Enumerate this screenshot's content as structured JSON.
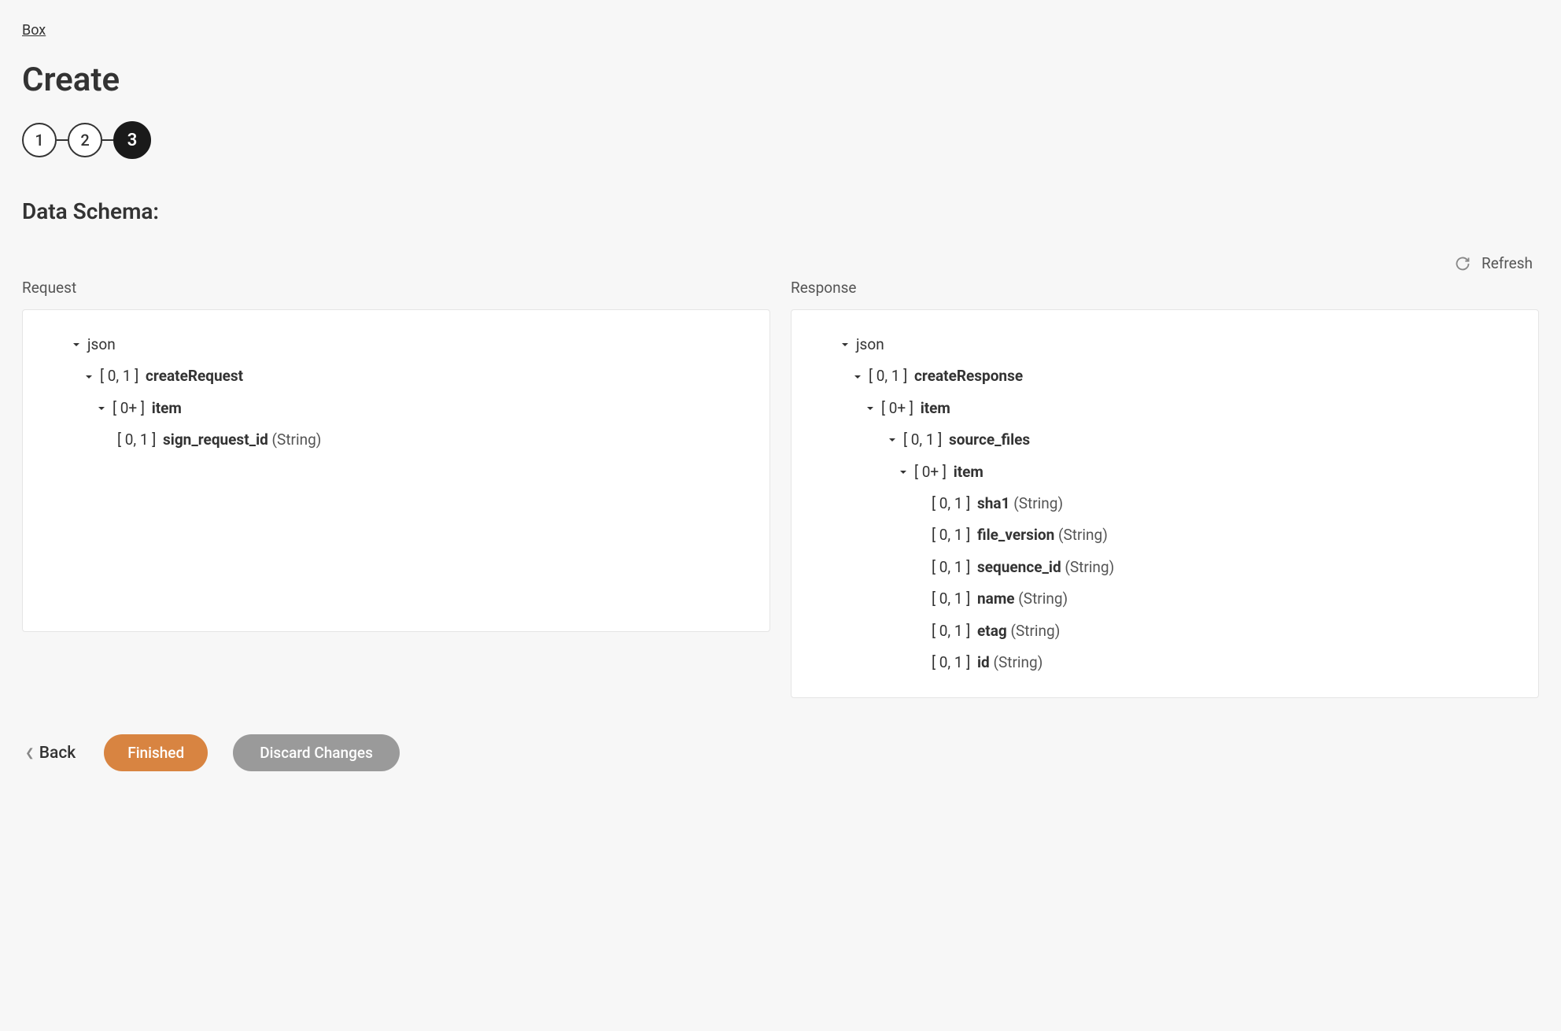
{
  "breadcrumb": {
    "label": "Box"
  },
  "page": {
    "title": "Create"
  },
  "stepper": {
    "step1": "1",
    "step2": "2",
    "step3": "3"
  },
  "section": {
    "title": "Data Schema:"
  },
  "refresh": {
    "label": "Refresh"
  },
  "request": {
    "label": "Request",
    "tree": {
      "root": "json",
      "node1": {
        "cardinality": "[ 0, 1 ]",
        "name": "createRequest"
      },
      "node2": {
        "cardinality": "[ 0+ ]",
        "name": "item"
      },
      "node3": {
        "cardinality": "[ 0, 1 ]",
        "name": "sign_request_id",
        "type": "(String)"
      }
    }
  },
  "response": {
    "label": "Response",
    "tree": {
      "root": "json",
      "node1": {
        "cardinality": "[ 0, 1 ]",
        "name": "createResponse"
      },
      "node2": {
        "cardinality": "[ 0+ ]",
        "name": "item"
      },
      "node3": {
        "cardinality": "[ 0, 1 ]",
        "name": "source_files"
      },
      "node4": {
        "cardinality": "[ 0+ ]",
        "name": "item"
      },
      "leaf1": {
        "cardinality": "[ 0, 1 ]",
        "name": "sha1",
        "type": "(String)"
      },
      "leaf2": {
        "cardinality": "[ 0, 1 ]",
        "name": "file_version",
        "type": "(String)"
      },
      "leaf3": {
        "cardinality": "[ 0, 1 ]",
        "name": "sequence_id",
        "type": "(String)"
      },
      "leaf4": {
        "cardinality": "[ 0, 1 ]",
        "name": "name",
        "type": "(String)"
      },
      "leaf5": {
        "cardinality": "[ 0, 1 ]",
        "name": "etag",
        "type": "(String)"
      },
      "leaf6": {
        "cardinality": "[ 0, 1 ]",
        "name": "id",
        "type": "(String)"
      }
    }
  },
  "footer": {
    "back": "Back",
    "finished": "Finished",
    "discard": "Discard Changes"
  }
}
